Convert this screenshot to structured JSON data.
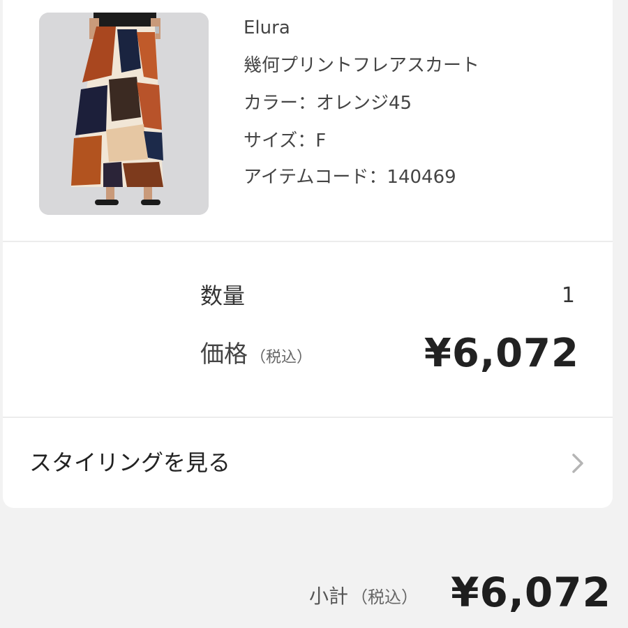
{
  "product": {
    "brand": "Elura",
    "name": "幾何プリントフレアスカート",
    "color": "カラー：オレンジ45",
    "size": "サイズ：F",
    "item_code": "アイテムコード：140469"
  },
  "order": {
    "quantity_label": "数量",
    "quantity_value": "1",
    "price_label": "価格",
    "tax_note": "（税込）",
    "price_value": "¥6,072"
  },
  "styling": {
    "label": "スタイリングを見る",
    "icon": "chevron-right-icon"
  },
  "summary": {
    "subtotal_label": "小計",
    "tax_note": "（税込）",
    "subtotal_value": "¥6,072"
  },
  "colors": {
    "page_bg": "#f2f2f2",
    "card_bg": "#ffffff",
    "divider": "#ececec",
    "chevron": "#b5b5b5"
  }
}
